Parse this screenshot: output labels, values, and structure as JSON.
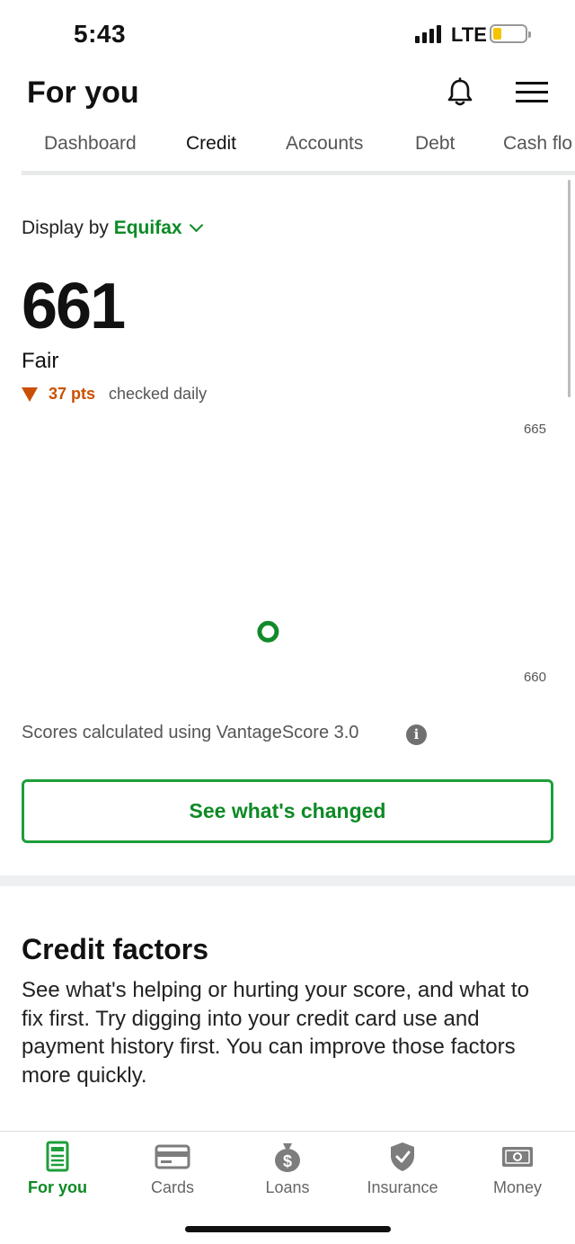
{
  "status_bar": {
    "time": "5:43",
    "network": "LTE"
  },
  "header": {
    "title": "For you"
  },
  "tabs": [
    {
      "label": "Dashboard",
      "active": false
    },
    {
      "label": "Credit",
      "active": true
    },
    {
      "label": "Accounts",
      "active": false
    },
    {
      "label": "Debt",
      "active": false
    },
    {
      "label": "Cash flo",
      "active": false
    }
  ],
  "score_panel": {
    "display_by_label": "Display by",
    "bureau": "Equifax",
    "score": "661",
    "rating": "Fair",
    "change": "37 pts",
    "frequency": "checked daily"
  },
  "chart_data": {
    "type": "scatter",
    "y_tick_labels": [
      "665",
      "660"
    ],
    "ylim": [
      660,
      665
    ],
    "points": [
      {
        "y": 661
      }
    ],
    "grid": false,
    "marker_color": "#128a2a"
  },
  "model_note": "Scores calculated using VantageScore 3.0",
  "cta": {
    "label": "See what's changed"
  },
  "credit_factors": {
    "title": "Credit factors",
    "body": "See what's helping or hurting your score, and what to fix first. Try digging into your credit card use and payment history first. You can improve those factors more quickly."
  },
  "bottom_nav": [
    {
      "label": "For you",
      "icon": "document-icon",
      "active": true
    },
    {
      "label": "Cards",
      "icon": "credit-card-icon",
      "active": false
    },
    {
      "label": "Loans",
      "icon": "money-bag-icon",
      "active": false
    },
    {
      "label": "Insurance",
      "icon": "shield-check-icon",
      "active": false
    },
    {
      "label": "Money",
      "icon": "banknote-icon",
      "active": false
    }
  ],
  "colors": {
    "accent": "#1e9e3a",
    "accent_text": "#0d8a25",
    "decline": "#c95000"
  }
}
